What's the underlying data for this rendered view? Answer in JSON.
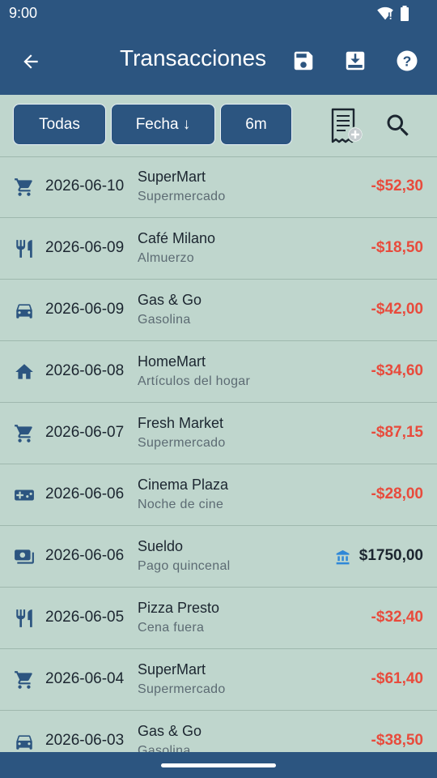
{
  "status": {
    "time": "9:00"
  },
  "appbar": {
    "title": "Transacciones"
  },
  "filters": {
    "all_label": "Todas",
    "sort_label": "Fecha ↓",
    "range_label": "6m"
  },
  "colors": {
    "primary": "#2c5580",
    "background": "#bfd6cd",
    "negative": "#e84b3c",
    "income_icon": "#2f88d8"
  },
  "transactions": [
    {
      "icon": "cart-icon",
      "date": "2026-06-10",
      "name": "SuperMart",
      "category": "Supermercado",
      "amount": "-$52,30",
      "type": "expense"
    },
    {
      "icon": "restaurant-icon",
      "date": "2026-06-09",
      "name": "Café Milano",
      "category": "Almuerzo",
      "amount": "-$18,50",
      "type": "expense"
    },
    {
      "icon": "car-icon",
      "date": "2026-06-09",
      "name": "Gas & Go",
      "category": "Gasolina",
      "amount": "-$42,00",
      "type": "expense"
    },
    {
      "icon": "home-icon",
      "date": "2026-06-08",
      "name": "HomeMart",
      "category": "Artículos del hogar",
      "amount": "-$34,60",
      "type": "expense"
    },
    {
      "icon": "cart-icon",
      "date": "2026-06-07",
      "name": "Fresh Market",
      "category": "Supermercado",
      "amount": "-$87,15",
      "type": "expense"
    },
    {
      "icon": "gamepad-icon",
      "date": "2026-06-06",
      "name": "Cinema Plaza",
      "category": "Noche de cine",
      "amount": "-$28,00",
      "type": "expense"
    },
    {
      "icon": "money-icon",
      "date": "2026-06-06",
      "name": "Sueldo",
      "category": "Pago quincenal",
      "amount": "$1750,00",
      "type": "income"
    },
    {
      "icon": "restaurant-icon",
      "date": "2026-06-05",
      "name": "Pizza Presto",
      "category": "Cena fuera",
      "amount": "-$32,40",
      "type": "expense"
    },
    {
      "icon": "cart-icon",
      "date": "2026-06-04",
      "name": "SuperMart",
      "category": "Supermercado",
      "amount": "-$61,40",
      "type": "expense"
    },
    {
      "icon": "car-icon",
      "date": "2026-06-03",
      "name": "Gas & Go",
      "category": "Gasolina",
      "amount": "-$38,50",
      "type": "expense"
    }
  ]
}
